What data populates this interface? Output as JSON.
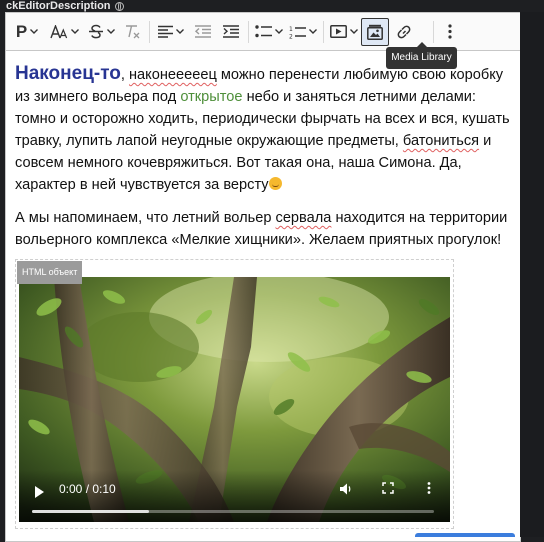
{
  "field": {
    "label": "ckEditorDescription",
    "globe_icon": "globe-icon"
  },
  "toolbar": {
    "heading_icon": "P",
    "buttons": [
      "paragraph-format",
      "font-size",
      "strikethrough",
      "remove-format",
      "align",
      "outdent",
      "indent",
      "bulleted-list",
      "numbered-list",
      "media-embed",
      "media-library",
      "link",
      "more"
    ],
    "tooltip": "Media Library"
  },
  "content": {
    "p1_headline": "Наконец-то",
    "p1_a": ", ",
    "p1_b": "наконееееец",
    "p1_c": " можно перенести любимую свою коробку из зимнего вольера под ",
    "p1_link": "открытое",
    "p1_d": " небо и заняться летними делами: томно и осторожно ходить, периодически фырчать на всех и вся, кушать травку, лупить лапой неугодные окружающие предметы, ",
    "p1_e": "батониться",
    "p1_f": " и совсем немного кочевряжиться. Вот такая она, наша Симона. Да, характер в ней чувствуется за версту",
    "p2_a": "А мы напоминаем, что летний вольер ",
    "p2_b": "сервала",
    "p2_c": " находится на территории вольерного комплекса «Мелкие хищники». Желаем приятных прогулок!"
  },
  "html_object": {
    "label": "HTML объект",
    "video": {
      "time": "0:00 / 0:10",
      "progress": 0.29
    }
  },
  "colors": {
    "headline": "#283593",
    "link": "#4e8f3a",
    "active_button": "#dfe8f5"
  }
}
